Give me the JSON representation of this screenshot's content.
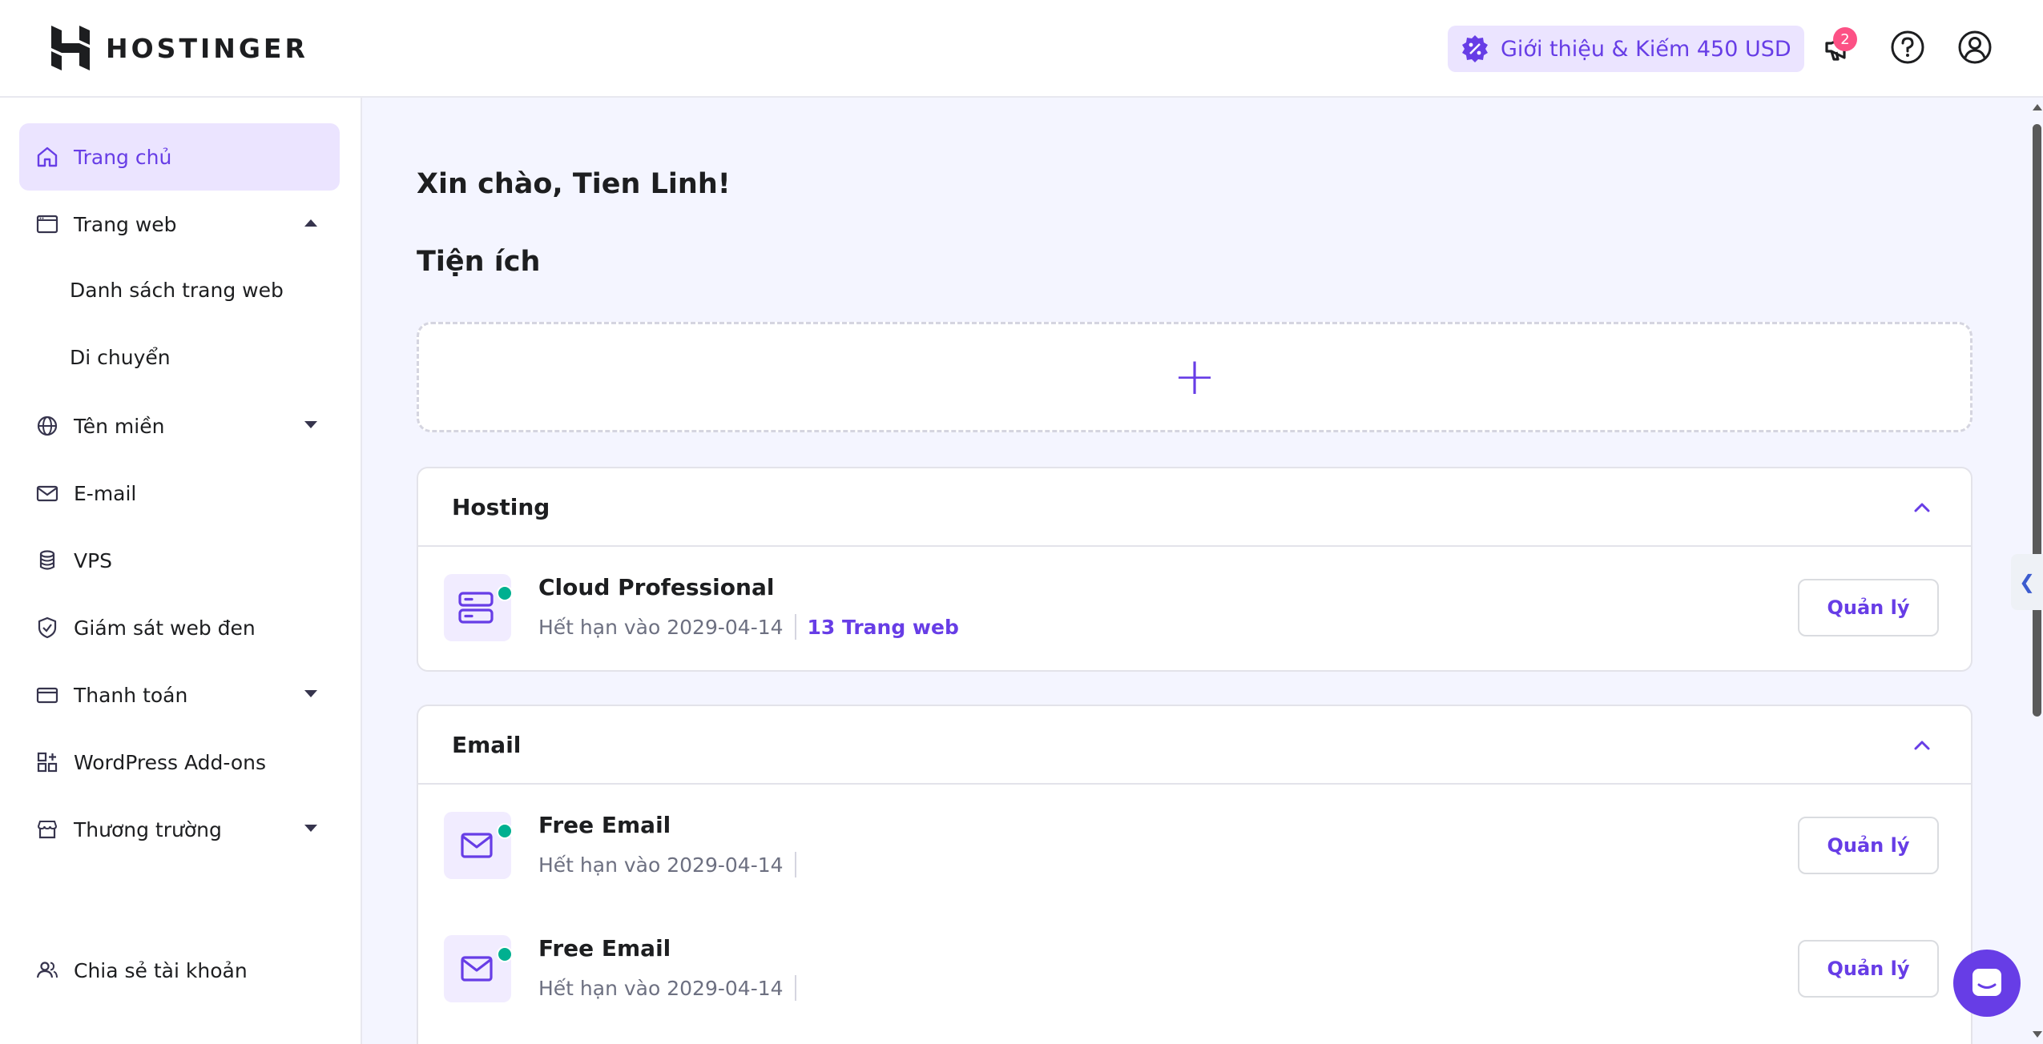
{
  "header": {
    "logo_text": "HOSTINGER",
    "referral_label": "Giới thiệu & Kiếm 450 USD",
    "notification_count": "2"
  },
  "sidebar": {
    "items": [
      {
        "label": "Trang chủ"
      },
      {
        "label": "Trang web"
      },
      {
        "label": "Tên miền"
      },
      {
        "label": "E-mail"
      },
      {
        "label": "VPS"
      },
      {
        "label": "Giám sát web đen"
      },
      {
        "label": "Thanh toán"
      },
      {
        "label": "WordPress Add-ons"
      },
      {
        "label": "Thương trường"
      },
      {
        "label": "Chia sẻ tài khoản"
      }
    ],
    "sub_items": [
      {
        "label": "Danh sách trang web"
      },
      {
        "label": "Di chuyển"
      }
    ]
  },
  "main": {
    "greeting": "Xin chào, Tien Linh!",
    "section_title": "Tiện ích",
    "add_symbol": "+",
    "hosting": {
      "title": "Hosting",
      "services": [
        {
          "name": "Cloud Professional",
          "expiry": "Hết hạn vào 2029-04-14",
          "link": "13 Trang web",
          "action": "Quản lý"
        }
      ]
    },
    "email": {
      "title": "Email",
      "services": [
        {
          "name": "Free Email",
          "expiry": "Hết hạn vào 2029-04-14",
          "action": "Quản lý"
        },
        {
          "name": "Free Email",
          "expiry": "Hết hạn vào 2029-04-14",
          "action": "Quản lý"
        }
      ]
    }
  },
  "side_tab_symbol": "❮",
  "colors": {
    "accent": "#673de6",
    "accent_light": "#ebe4ff",
    "status_active": "#00b090",
    "badge": "#fc5185",
    "background": "#f4f5ff"
  }
}
